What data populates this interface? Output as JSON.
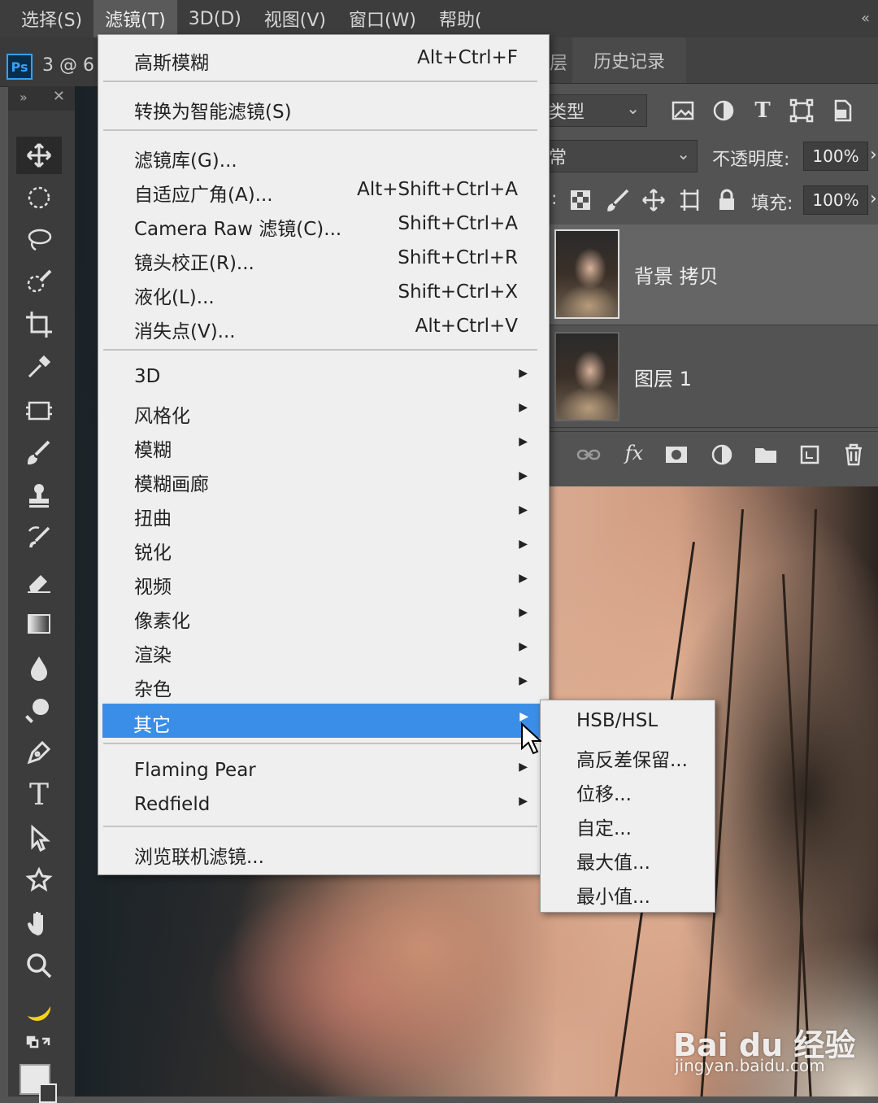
{
  "menubar": {
    "items": [
      "选择(S)",
      "滤镜(T)",
      "3D(D)",
      "视图(V)",
      "窗口(W)",
      "帮助("
    ],
    "active_index": 1,
    "collapse_glyph": "«"
  },
  "document": {
    "app_badge": "Ps",
    "tab_title": "3 @ 6"
  },
  "filter_menu": {
    "items": [
      {
        "label": "高斯模糊",
        "shortcut": "Alt+Ctrl+F"
      },
      {
        "label": "转换为智能滤镜(S)",
        "shortcut": ""
      },
      {
        "label": "滤镜库(G)...",
        "shortcut": ""
      },
      {
        "label": "自适应广角(A)...",
        "shortcut": "Alt+Shift+Ctrl+A"
      },
      {
        "label": "Camera Raw 滤镜(C)...",
        "shortcut": "Shift+Ctrl+A"
      },
      {
        "label": "镜头校正(R)...",
        "shortcut": "Shift+Ctrl+R"
      },
      {
        "label": "液化(L)...",
        "shortcut": "Shift+Ctrl+X"
      },
      {
        "label": "消失点(V)...",
        "shortcut": "Alt+Ctrl+V"
      },
      {
        "label": "3D",
        "submenu": true
      },
      {
        "label": "风格化",
        "submenu": true
      },
      {
        "label": "模糊",
        "submenu": true
      },
      {
        "label": "模糊画廊",
        "submenu": true
      },
      {
        "label": "扭曲",
        "submenu": true
      },
      {
        "label": "锐化",
        "submenu": true
      },
      {
        "label": "视频",
        "submenu": true
      },
      {
        "label": "像素化",
        "submenu": true
      },
      {
        "label": "渲染",
        "submenu": true
      },
      {
        "label": "杂色",
        "submenu": true
      },
      {
        "label": "其它",
        "submenu": true,
        "highlighted": true
      },
      {
        "label": "Flaming Pear",
        "submenu": true
      },
      {
        "label": "Redfield",
        "submenu": true
      },
      {
        "label": "浏览联机滤镜...",
        "shortcut": ""
      }
    ],
    "highlight_color": "#3a8ee8",
    "submenu_arrow": "▶"
  },
  "other_submenu": {
    "items": [
      "HSB/HSL",
      "高反差保留...",
      "位移...",
      "自定...",
      "最大值...",
      "最小值..."
    ]
  },
  "panels": {
    "tabs": {
      "left_fragment": "层",
      "history": "历史记录"
    },
    "kind_filter": "类型",
    "blend_mode": "常",
    "opacity_label": "不透明度:",
    "opacity_value": "100%",
    "fill_label": "填充:",
    "fill_value": "100%",
    "lock_prefix": ":",
    "layers": [
      {
        "name": "背景 拷贝",
        "selected": true
      },
      {
        "name": "图层 1",
        "selected": false
      }
    ],
    "footer_fx": "fx"
  },
  "tools": [
    "move-tool",
    "marquee-tool",
    "lasso-tool",
    "quick-select-tool",
    "crop-tool",
    "eyedropper-tool",
    "frame-tool",
    "brush-tool",
    "stamp-tool",
    "history-brush-tool",
    "eraser-tool",
    "gradient-tool",
    "blur-tool",
    "dodge-tool",
    "pen-tool",
    "type-tool",
    "path-select-tool",
    "shape-tool",
    "hand-tool",
    "zoom-tool",
    "banana-tool"
  ],
  "toolbar": {
    "head_glyph": "»",
    "close_glyph": "✕",
    "type_glyph": "T"
  },
  "watermark": {
    "logo": "Bai du 经验",
    "url": "jingyan.baidu.com"
  },
  "colors": {
    "accent": "#3a8ee8",
    "menubar": "#3d3d3d",
    "panel": "#535353"
  }
}
